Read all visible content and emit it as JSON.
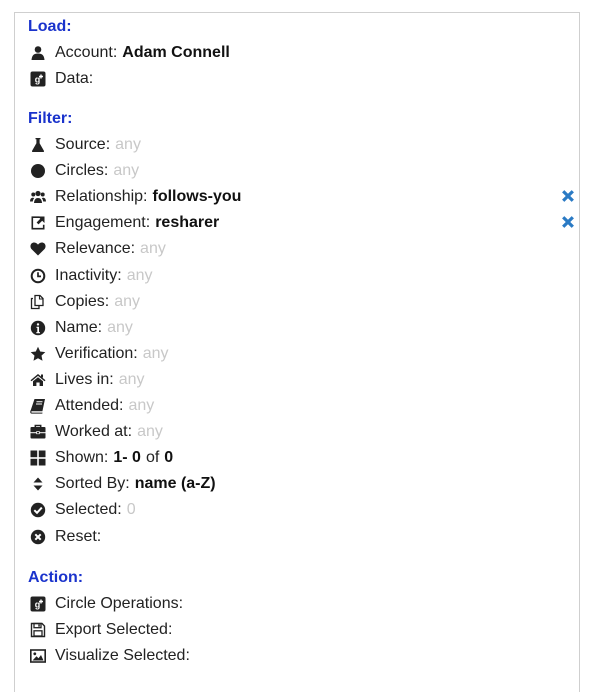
{
  "load": {
    "title": "Load:",
    "account_label": "Account:",
    "account_value": "Adam Connell",
    "data_label": "Data:"
  },
  "filter": {
    "title": "Filter:",
    "items": [
      {
        "icon": "flask-icon",
        "label": "Source:",
        "value": "any",
        "state": "any"
      },
      {
        "icon": "circle-icon",
        "label": "Circles:",
        "value": "any",
        "state": "any"
      },
      {
        "icon": "users-icon",
        "label": "Relationship:",
        "value": "follows-you",
        "state": "set",
        "removable": true
      },
      {
        "icon": "share-icon",
        "label": "Engagement:",
        "value": "resharer",
        "state": "set",
        "removable": true
      },
      {
        "icon": "heart-icon",
        "label": "Relevance:",
        "value": "any",
        "state": "any"
      },
      {
        "icon": "clock-icon",
        "label": "Inactivity:",
        "value": "any",
        "state": "any"
      },
      {
        "icon": "copy-icon",
        "label": "Copies:",
        "value": "any",
        "state": "any"
      },
      {
        "icon": "info-icon",
        "label": "Name:",
        "value": "any",
        "state": "any"
      },
      {
        "icon": "star-icon",
        "label": "Verification:",
        "value": "any",
        "state": "any"
      },
      {
        "icon": "home-icon",
        "label": "Lives in:",
        "value": "any",
        "state": "any"
      },
      {
        "icon": "book-icon",
        "label": "Attended:",
        "value": "any",
        "state": "any"
      },
      {
        "icon": "briefcase-icon",
        "label": "Worked at:",
        "value": "any",
        "state": "any"
      },
      {
        "icon": "grid-icon",
        "label": "Shown:",
        "value": "1- 0",
        "value_suffix": "of",
        "value_total": "0",
        "state": "shown"
      },
      {
        "icon": "sort-icon",
        "label": "Sorted By:",
        "value": "name (a-Z)",
        "state": "set"
      },
      {
        "icon": "check-circle-icon",
        "label": "Selected:",
        "value": "0",
        "state": "any"
      },
      {
        "icon": "x-circle-icon",
        "label": "Reset:",
        "value": "",
        "state": "none"
      }
    ]
  },
  "action": {
    "title": "Action:",
    "items": [
      {
        "icon": "google-plus-icon",
        "label": "Circle Operations:"
      },
      {
        "icon": "save-icon",
        "label": "Export Selected:"
      },
      {
        "icon": "image-icon",
        "label": "Visualize Selected:"
      }
    ]
  },
  "colors": {
    "section_title": "#1a33cc",
    "remove": "#2a7ac4",
    "muted": "#c8c8c8"
  }
}
